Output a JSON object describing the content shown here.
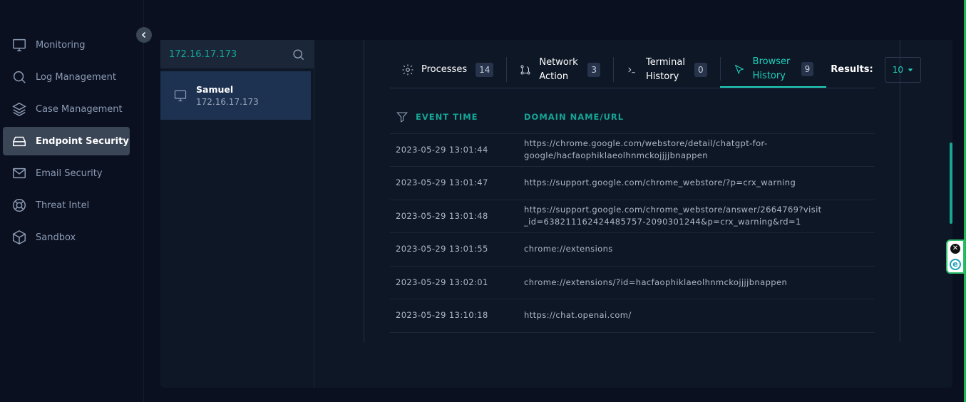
{
  "sidebar": {
    "items": [
      {
        "label": "Monitoring",
        "icon": "monitor-icon",
        "active": false
      },
      {
        "label": "Log Management",
        "icon": "search-icon",
        "active": false
      },
      {
        "label": "Case Management",
        "icon": "layers-icon",
        "active": false
      },
      {
        "label": "Endpoint Security",
        "icon": "hard-drive-icon",
        "active": true
      },
      {
        "label": "Email Security",
        "icon": "mail-icon",
        "active": false
      },
      {
        "label": "Threat Intel",
        "icon": "lifebuoy-icon",
        "active": false
      },
      {
        "label": "Sandbox",
        "icon": "box-icon",
        "active": false
      }
    ]
  },
  "hosts": {
    "search_value": "172.16.17.173",
    "items": [
      {
        "name": "Samuel",
        "ip": "172.16.17.173"
      }
    ]
  },
  "tabs": [
    {
      "label": "Processes",
      "count": "14",
      "icon": "gear-icon",
      "active": false
    },
    {
      "label": "Network Action",
      "count": "3",
      "icon": "network-icon",
      "active": false
    },
    {
      "label": "Terminal History",
      "count": "0",
      "icon": "terminal-icon",
      "active": false
    },
    {
      "label": "Browser History",
      "count": "9",
      "icon": "cursor-icon",
      "active": true
    }
  ],
  "results": {
    "label": "Results:",
    "value": "10"
  },
  "table": {
    "headers": [
      "EVENT TIME",
      "DOMAIN NAME/URL"
    ],
    "rows": [
      {
        "time": "2023-05-29 13:01:44",
        "url": "https://chrome.google.com/webstore/detail/chatgpt-for-google/hacfaophiklaeolhnmckojjjjbnappen"
      },
      {
        "time": "2023-05-29 13:01:47",
        "url": "https://support.google.com/chrome_webstore/?p=crx_warning"
      },
      {
        "time": "2023-05-29 13:01:48",
        "url": "https://support.google.com/chrome_webstore/answer/2664769?visit_id=638211162424485757-2090301244&p=crx_warning&rd=1"
      },
      {
        "time": "2023-05-29 13:01:55",
        "url": "chrome://extensions"
      },
      {
        "time": "2023-05-29 13:02:01",
        "url": "chrome://extensions/?id=hacfaophiklaeolhnmckojjjjbnappen"
      },
      {
        "time": "2023-05-29 13:10:18",
        "url": "https://chat.openai.com/"
      }
    ]
  },
  "colors": {
    "accent": "#1fd1bd",
    "active_nav": "#3a4556",
    "panel": "#0e1726"
  }
}
